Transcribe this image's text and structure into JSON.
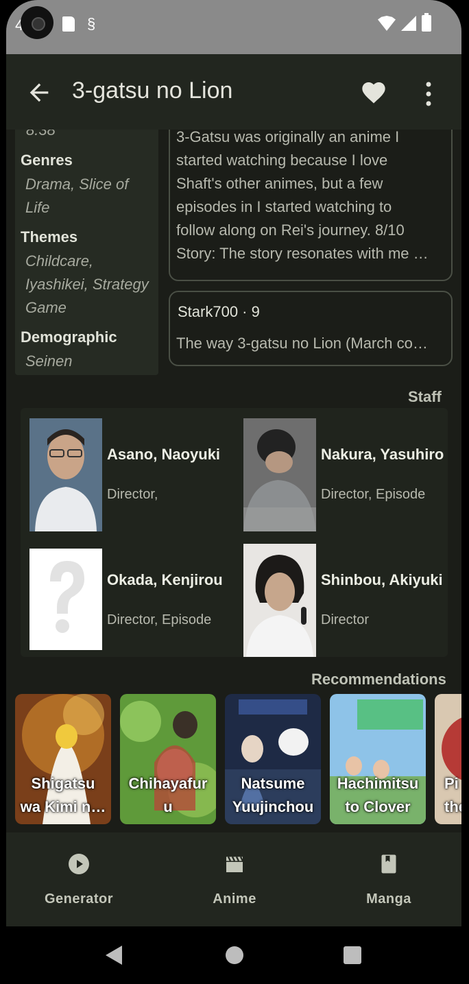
{
  "status": {
    "left_digit": "4"
  },
  "appbar": {
    "title": "3-gatsu no Lion",
    "favorited": true
  },
  "info": {
    "score": "8.38",
    "genres_label": "Genres",
    "genres": "Drama, Slice of Life",
    "themes_label": "Themes",
    "themes": "Childcare, Iyashikei, Strategy Game",
    "demographic_label": "Demographic",
    "demographic": "Seinen"
  },
  "reviews": [
    {
      "lines": [
        "3-Gatsu was originally an anime I",
        "started watching because I love",
        "Shaft's other animes, but a few",
        "episodes in I started watching to",
        "follow along on Rei's journey. 8/10",
        "Story: The story resonates with me …"
      ]
    },
    {
      "user": "Stark700 · 9",
      "text": "The way 3-gatsu no Lion (March co…"
    }
  ],
  "staff_section": {
    "title": "Staff",
    "members": [
      {
        "name": "Asano, Naoyuki",
        "role": "Director,"
      },
      {
        "name": "Nakura, Yasuhiro",
        "role": "Director, Episode"
      },
      {
        "name": "Okada, Kenjirou",
        "role": "Director, Episode"
      },
      {
        "name": "Shinbou, Akiyuki",
        "role": "Director"
      }
    ]
  },
  "recommendations": {
    "title": "Recommendations",
    "items": [
      {
        "line1": "Shigatsu",
        "line2": "wa Kimi n…"
      },
      {
        "line1": "Chihayafur",
        "line2": "u"
      },
      {
        "line1": "Natsume",
        "line2": "Yuujinchou"
      },
      {
        "line1": "Hachimitsu",
        "line2": "to Clover"
      },
      {
        "line1": "Pi",
        "line2": "the"
      }
    ]
  },
  "bottom_nav": {
    "generator": "Generator",
    "anime": "Anime",
    "manga": "Manga"
  },
  "colors": {
    "background": "#1b1d18",
    "surface": "#22261f",
    "text": "#e4e4dc"
  }
}
